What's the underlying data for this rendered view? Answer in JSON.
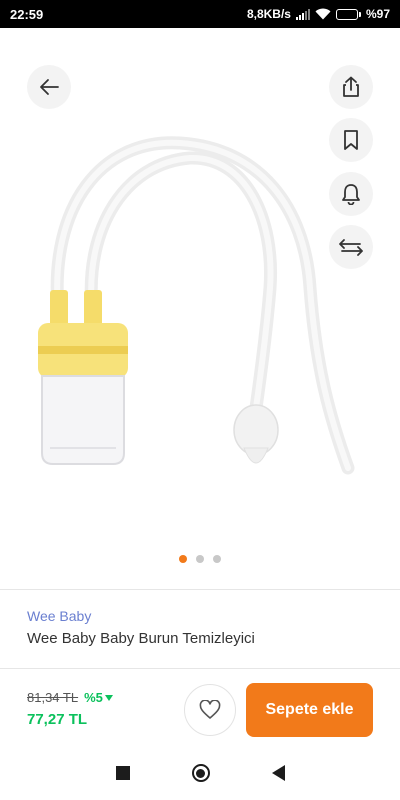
{
  "status_bar": {
    "time": "22:59",
    "network_speed": "8,8KB/s",
    "battery_percent": "%97",
    "battery_level": 0.97,
    "icons": [
      "signal-icon",
      "wifi-icon",
      "battery-icon"
    ]
  },
  "gallery": {
    "image_subject": "nasal aspirator with yellow cap and two clear tubes",
    "page_count": 3,
    "active_page": 1,
    "actions": [
      "share-icon",
      "bookmark-icon",
      "bell-icon",
      "compare-arrows-icon"
    ],
    "back_icon": "arrow-left-icon"
  },
  "product": {
    "brand": "Wee Baby",
    "title": "Wee Baby Baby Burun Temizleyici"
  },
  "pricing": {
    "old_price": "81,34 TL",
    "discount": "%5",
    "new_price": "77,27 TL"
  },
  "actions": {
    "favorite_icon": "heart-icon",
    "add_to_cart_label": "Sepete ekle"
  },
  "nav": {
    "icons": [
      "recent-apps-icon",
      "home-icon",
      "back-icon"
    ]
  },
  "colors": {
    "accent": "#f27a1a",
    "brand_link": "#6a7fd0",
    "discount_green": "#0bc15c",
    "product_yellow": "#f7e27a"
  }
}
